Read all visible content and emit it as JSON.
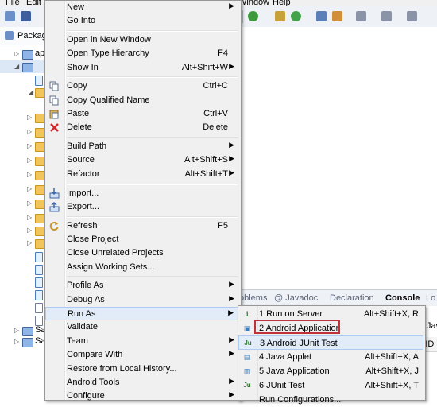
{
  "menubar": {
    "file": "File",
    "edit": "Edit",
    "window": "Window",
    "help": "Help"
  },
  "package_explorer": {
    "tab_title": "Package",
    "tree_first": "app",
    "tree_sal1": "Sal",
    "tree_sal2": "Sal"
  },
  "bottom_panel": {
    "tabs": [
      "oblems",
      "@ Javadoc",
      "Declaration",
      "Console",
      "Lo"
    ],
    "body_text": "epts Java",
    "column_header": "PID"
  },
  "context_menu": {
    "items": [
      {
        "label": "New",
        "shortcut": "",
        "submenu": true
      },
      {
        "label": "Go Into",
        "shortcut": ""
      },
      {
        "sep": true
      },
      {
        "label": "Open in New Window",
        "shortcut": ""
      },
      {
        "label": "Open Type Hierarchy",
        "shortcut": "F4"
      },
      {
        "label": "Show In",
        "shortcut": "Alt+Shift+W",
        "submenu": true
      },
      {
        "sep": true
      },
      {
        "label": "Copy",
        "shortcut": "Ctrl+C",
        "icon": "copy-icon"
      },
      {
        "label": "Copy Qualified Name",
        "shortcut": "",
        "icon": "copy-qualified-name-icon"
      },
      {
        "label": "Paste",
        "shortcut": "Ctrl+V",
        "icon": "paste-icon"
      },
      {
        "label": "Delete",
        "shortcut": "Delete",
        "icon": "delete-icon"
      },
      {
        "sep": true
      },
      {
        "label": "Build Path",
        "shortcut": "",
        "submenu": true
      },
      {
        "label": "Source",
        "shortcut": "Alt+Shift+S",
        "submenu": true
      },
      {
        "label": "Refactor",
        "shortcut": "Alt+Shift+T",
        "submenu": true
      },
      {
        "sep": true
      },
      {
        "label": "Import...",
        "shortcut": "",
        "icon": "import-icon"
      },
      {
        "label": "Export...",
        "shortcut": "",
        "icon": "export-icon"
      },
      {
        "sep": true
      },
      {
        "label": "Refresh",
        "shortcut": "F5",
        "icon": "refresh-icon"
      },
      {
        "label": "Close Project",
        "shortcut": ""
      },
      {
        "label": "Close Unrelated Projects",
        "shortcut": ""
      },
      {
        "label": "Assign Working Sets...",
        "shortcut": ""
      },
      {
        "sep": true
      },
      {
        "label": "Profile As",
        "shortcut": "",
        "submenu": true
      },
      {
        "label": "Debug As",
        "shortcut": "",
        "submenu": true
      },
      {
        "label": "Run As",
        "shortcut": "",
        "submenu": true,
        "highlighted": true
      },
      {
        "label": "Validate",
        "shortcut": ""
      },
      {
        "label": "Team",
        "shortcut": "",
        "submenu": true
      },
      {
        "label": "Compare With",
        "shortcut": "",
        "submenu": true
      },
      {
        "label": "Restore from Local History...",
        "shortcut": ""
      },
      {
        "label": "Android Tools",
        "shortcut": "",
        "submenu": true
      },
      {
        "label": "Configure",
        "shortcut": "",
        "submenu": true
      }
    ]
  },
  "run_as_submenu": {
    "items": [
      {
        "label": "1 Run on Server",
        "shortcut": "Alt+Shift+X, R",
        "icon": "server-icon",
        "glyph": "1"
      },
      {
        "label": "2 Android Application",
        "shortcut": "",
        "icon": "android-app-icon",
        "glyph": "▣",
        "boxed": true
      },
      {
        "label": "3 Android JUnit Test",
        "shortcut": "",
        "icon": "junit-icon",
        "glyph": "Ju",
        "highlighted": true
      },
      {
        "label": "4 Java Applet",
        "shortcut": "Alt+Shift+X, A",
        "icon": "applet-icon",
        "glyph": "▤"
      },
      {
        "label": "5 Java Application",
        "shortcut": "Alt+Shift+X, J",
        "icon": "java-app-icon",
        "glyph": "▥"
      },
      {
        "label": "6 JUnit Test",
        "shortcut": "Alt+Shift+X, T",
        "icon": "junit-test-icon",
        "glyph": "Ju"
      },
      {
        "label": "Run Configurations...",
        "shortcut": ""
      }
    ]
  }
}
